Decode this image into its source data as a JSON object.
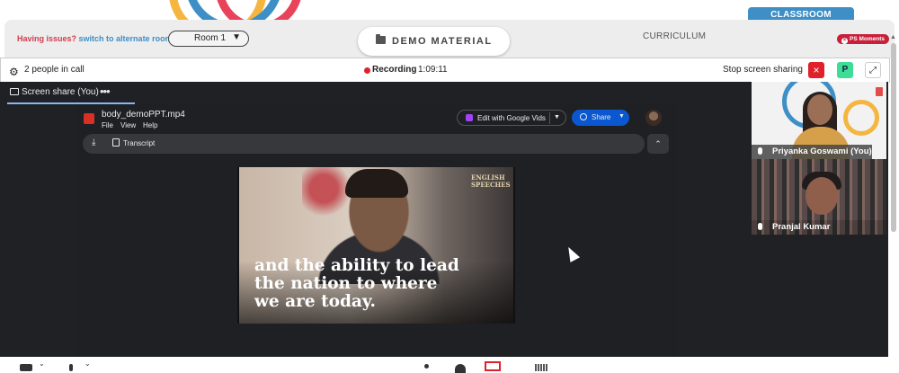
{
  "header": {
    "classroom_tab": "CLASSROOM",
    "issues_text": "Having issues?",
    "issues_link": "switch to alternate room",
    "room_selected": "Room 1",
    "demo_button": "DEMO MATERIAL",
    "curriculum_tab": "CURRICULUM",
    "moments_badge": "PS Moments"
  },
  "call_bar": {
    "people_count": "2 people in call",
    "recording_label": "Recording",
    "recording_time": "1:09:11",
    "stop_sharing": "Stop screen sharing",
    "stop_icon": "×",
    "participant_avatar": "P",
    "expand_icon": "⤢"
  },
  "share": {
    "tab_label": "Screen share (You)",
    "tab_more": "•••",
    "file_name": "body_demoPPT.mp4",
    "menus": [
      "File",
      "View",
      "Help"
    ],
    "edit_button": "Edit with Google Vids",
    "share_button": "Share",
    "transcript_button": "Transcript",
    "caption_lines": [
      "and the ability to lead",
      "the nation to where",
      "we are today."
    ],
    "watermark_lines": [
      "ENGLISH",
      "SPEECHES"
    ]
  },
  "participants": [
    {
      "name": "Priyanka Goswami (You)"
    },
    {
      "name": "Pranjal Kumar"
    }
  ],
  "colors": {
    "accent_blue": "#3d8fc6",
    "alert_red": "#d33c4b",
    "recording_red": "#e0202a",
    "dark_bg": "#202124"
  }
}
